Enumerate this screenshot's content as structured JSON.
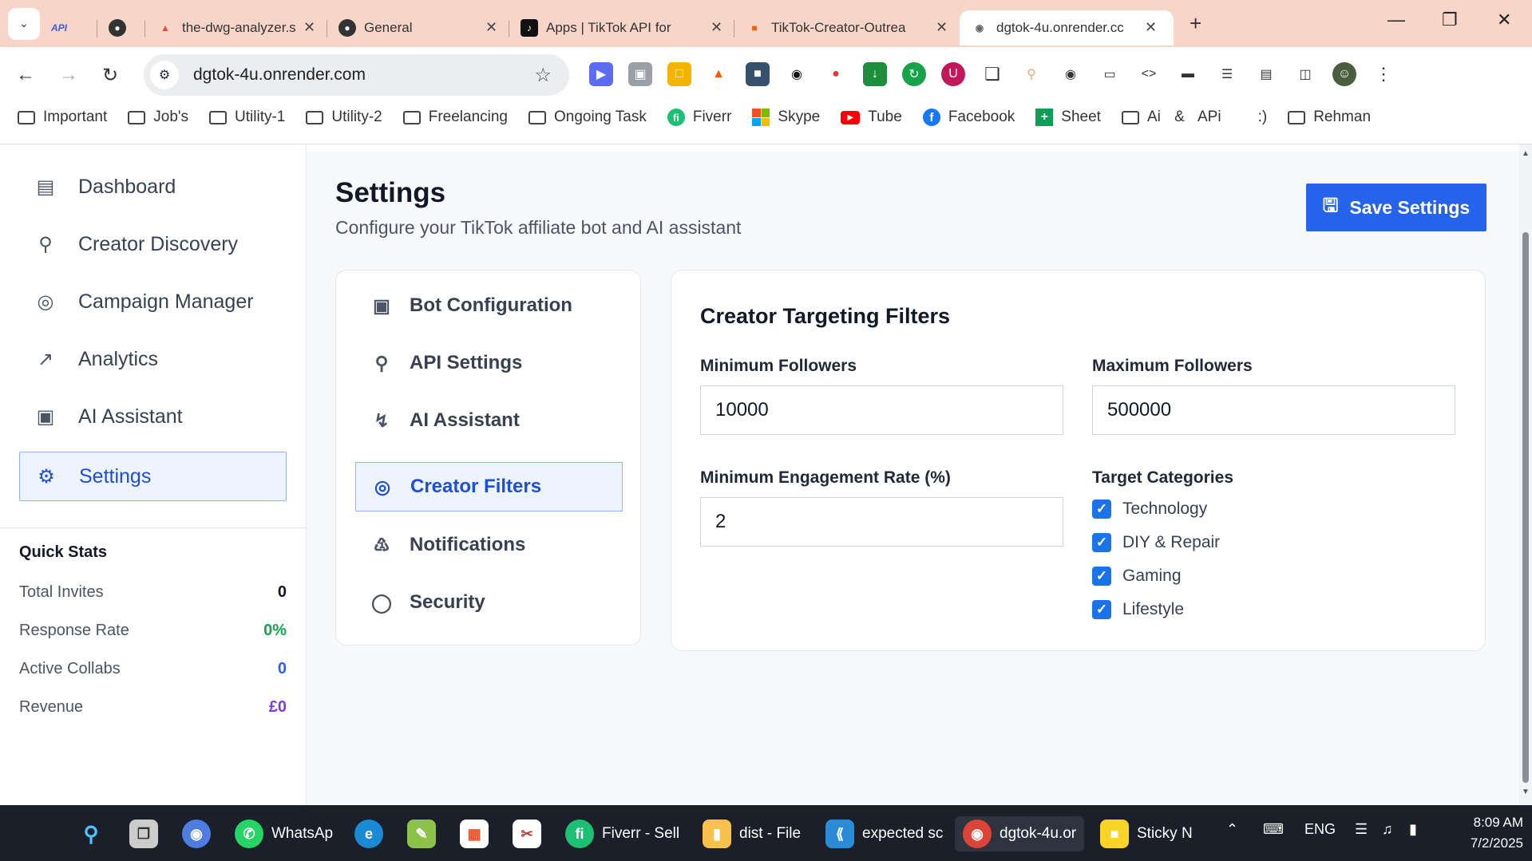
{
  "browser": {
    "tabs": [
      {
        "title": "API",
        "icon": "api-badge-icon"
      },
      {
        "title": "",
        "icon": "github-icon"
      },
      {
        "title": "the-dwg-analyzer.stre",
        "icon": "streamlit-icon"
      },
      {
        "title": "General",
        "icon": "github-icon"
      },
      {
        "title": "Apps | TikTok API for",
        "icon": "tiktok-icon"
      },
      {
        "title": "TikTok-Creator-Outrea",
        "icon": "replit-icon"
      },
      {
        "title": "dgtok-4u.onrender.cc",
        "icon": "globe-icon"
      }
    ],
    "url": "dgtok-4u.onrender.com",
    "bookmarks": [
      {
        "label": "Important",
        "type": "folder"
      },
      {
        "label": "Job's",
        "type": "folder"
      },
      {
        "label": "Utility-1",
        "type": "folder"
      },
      {
        "label": "Utility-2",
        "type": "folder"
      },
      {
        "label": "Freelancing",
        "type": "folder"
      },
      {
        "label": "Ongoing Task",
        "type": "folder"
      },
      {
        "label": "Fiverr",
        "type": "fiverr"
      },
      {
        "label": "Skype",
        "type": "skype"
      },
      {
        "label": "Tube",
        "type": "youtube"
      },
      {
        "label": "Facebook",
        "type": "facebook"
      },
      {
        "label": "Sheet",
        "type": "sheets"
      },
      {
        "label": "Ai & APi",
        "type": "folder"
      },
      {
        "label": ":)",
        "type": "none"
      },
      {
        "label": "Rehman",
        "type": "folder"
      }
    ]
  },
  "sidebar": {
    "items": [
      {
        "label": "Dashboard",
        "icon": "bar-chart-icon"
      },
      {
        "label": "Creator Discovery",
        "icon": "search-icon"
      },
      {
        "label": "Campaign Manager",
        "icon": "target-icon"
      },
      {
        "label": "Analytics",
        "icon": "trending-up-icon"
      },
      {
        "label": "AI Assistant",
        "icon": "bot-icon"
      },
      {
        "label": "Settings",
        "icon": "gear-icon"
      }
    ],
    "quick_stats": {
      "title": "Quick Stats",
      "rows": [
        {
          "label": "Total Invites",
          "value": "0",
          "color": "#111827"
        },
        {
          "label": "Response Rate",
          "value": "0%",
          "color": "#16a34a"
        },
        {
          "label": "Active Collabs",
          "value": "0",
          "color": "#2563eb"
        },
        {
          "label": "Revenue",
          "value": "£0",
          "color": "#7c3aed"
        }
      ]
    }
  },
  "main": {
    "title": "Settings",
    "subtitle": "Configure your TikTok affiliate bot and AI assistant",
    "save_label": "Save Settings",
    "settings_menu": [
      {
        "label": "Bot Configuration",
        "icon": "bot-icon"
      },
      {
        "label": "API Settings",
        "icon": "key-icon"
      },
      {
        "label": "AI Assistant",
        "icon": "lightning-icon"
      },
      {
        "label": "Creator Filters",
        "icon": "target-icon"
      },
      {
        "label": "Notifications",
        "icon": "bell-icon"
      },
      {
        "label": "Security",
        "icon": "shield-icon"
      }
    ],
    "filters": {
      "title": "Creator Targeting Filters",
      "min_followers_label": "Minimum Followers",
      "min_followers_value": "10000",
      "max_followers_label": "Maximum Followers",
      "max_followers_value": "500000",
      "min_engagement_label": "Minimum Engagement Rate (%)",
      "min_engagement_value": "2",
      "categories_label": "Target Categories",
      "categories": [
        {
          "label": "Technology",
          "checked": true
        },
        {
          "label": "DIY & Repair",
          "checked": true
        },
        {
          "label": "Gaming",
          "checked": true
        },
        {
          "label": "Lifestyle",
          "checked": true
        }
      ]
    }
  },
  "taskbar": {
    "items": [
      {
        "label": "WhatsAp"
      },
      {
        "label": "Fiverr - Sell"
      },
      {
        "label": "dist - File"
      },
      {
        "label": "expected sc"
      },
      {
        "label": "dgtok-4u.or"
      },
      {
        "label": "Sticky N"
      }
    ],
    "language": "ENG",
    "time": "8:09 AM",
    "date": "7/2/2025"
  },
  "colors": {
    "accent": "#2563eb",
    "tab_strip": "#f7d6c9",
    "active_nav_bg": "#eef4ff"
  }
}
